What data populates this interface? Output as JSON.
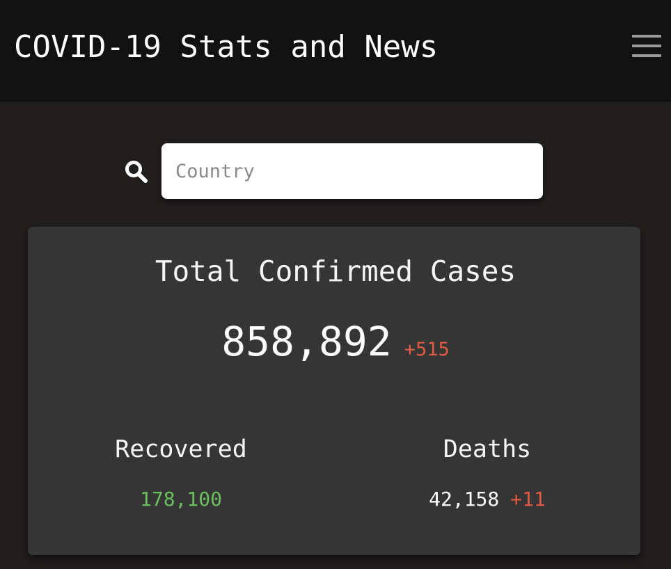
{
  "header": {
    "title": "COVID-19 Stats and News",
    "menu_icon": "hamburger-menu-icon"
  },
  "search": {
    "icon": "search-icon",
    "placeholder": "Country",
    "value": ""
  },
  "stats": {
    "title": "Total Confirmed Cases",
    "total_confirmed": "858,892",
    "total_confirmed_delta": "+515",
    "recovered": {
      "label": "Recovered",
      "value": "178,100"
    },
    "deaths": {
      "label": "Deaths",
      "value": "42,158",
      "delta": "+11"
    }
  },
  "colors": {
    "header_bg": "#111111",
    "page_bg": "#211f1e",
    "card_bg": "#353535",
    "increase_red": "#e05a43",
    "recovered_green": "#6abf5e"
  }
}
